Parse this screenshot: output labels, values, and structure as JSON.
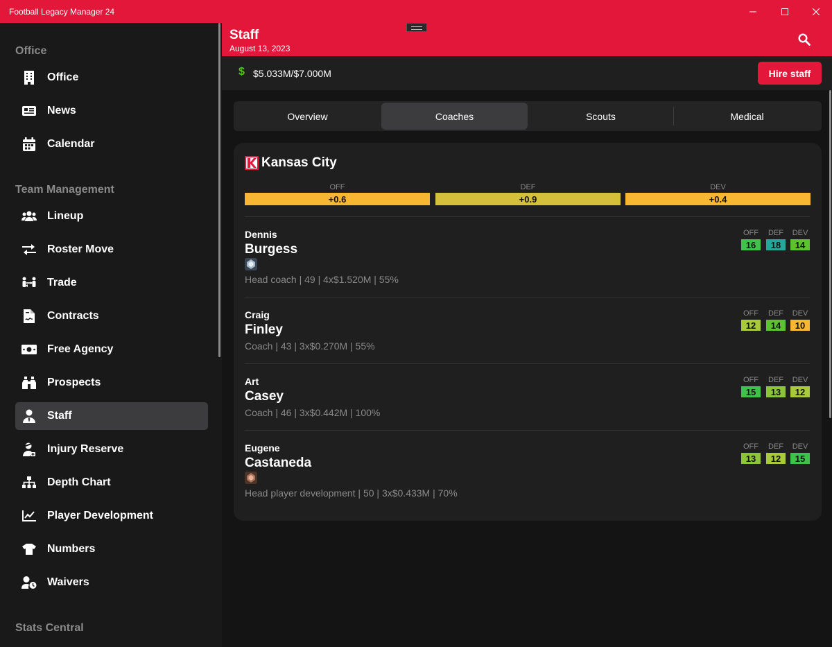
{
  "window": {
    "title": "Football Legacy Manager 24"
  },
  "sidebar": {
    "sections": [
      {
        "label": "Office"
      },
      {
        "label": "Team Management"
      },
      {
        "label": "Stats Central"
      }
    ],
    "items": [
      {
        "label": "Office",
        "icon": "building-icon"
      },
      {
        "label": "News",
        "icon": "newspaper-icon"
      },
      {
        "label": "Calendar",
        "icon": "calendar-icon"
      },
      {
        "label": "Lineup",
        "icon": "users-icon"
      },
      {
        "label": "Roster Move",
        "icon": "arrows-exchange-icon"
      },
      {
        "label": "Trade",
        "icon": "trade-icon"
      },
      {
        "label": "Contracts",
        "icon": "contract-icon"
      },
      {
        "label": "Free Agency",
        "icon": "money-bill-icon"
      },
      {
        "label": "Prospects",
        "icon": "binoculars-icon"
      },
      {
        "label": "Staff",
        "icon": "staff-icon",
        "active": true
      },
      {
        "label": "Injury Reserve",
        "icon": "injured-icon"
      },
      {
        "label": "Depth Chart",
        "icon": "hierarchy-icon"
      },
      {
        "label": "Player Development",
        "icon": "chart-line-icon"
      },
      {
        "label": "Numbers",
        "icon": "shirt-icon"
      },
      {
        "label": "Waivers",
        "icon": "user-clock-icon"
      }
    ]
  },
  "header": {
    "title": "Staff",
    "date": "August 13, 2023"
  },
  "budget": {
    "symbol": "$",
    "text": "$5.033M/$7.000M",
    "hire_label": "Hire staff"
  },
  "tabs": [
    {
      "label": "Overview"
    },
    {
      "label": "Coaches",
      "active": true
    },
    {
      "label": "Scouts"
    },
    {
      "label": "Medical"
    }
  ],
  "team": {
    "name": "Kansas City",
    "logo_letter": "K",
    "ratings": [
      {
        "label": "OFF",
        "value": "+0.6",
        "color": "#f7b733"
      },
      {
        "label": "DEF",
        "value": "+0.9",
        "color": "#d4c03a"
      },
      {
        "label": "DEV",
        "value": "+0.4",
        "color": "#f7b733"
      }
    ]
  },
  "coaches": [
    {
      "first": "Dennis",
      "last": "Burgess",
      "badge": "silver-badge-icon",
      "meta": "Head coach | 49 | 4x$1.520M | 55%",
      "stats": [
        {
          "label": "OFF",
          "value": "16",
          "color": "#3ec24a"
        },
        {
          "label": "DEF",
          "value": "18",
          "color": "#26a69a"
        },
        {
          "label": "DEV",
          "value": "14",
          "color": "#5cc232"
        }
      ]
    },
    {
      "first": "Craig",
      "last": "Finley",
      "badge": null,
      "meta": "Coach | 43 | 3x$0.270M | 55%",
      "stats": [
        {
          "label": "OFF",
          "value": "12",
          "color": "#a8c93a"
        },
        {
          "label": "DEF",
          "value": "14",
          "color": "#5cc232"
        },
        {
          "label": "DEV",
          "value": "10",
          "color": "#f7b733"
        }
      ]
    },
    {
      "first": "Art",
      "last": "Casey",
      "badge": null,
      "meta": "Coach | 46 | 3x$0.442M | 100%",
      "stats": [
        {
          "label": "OFF",
          "value": "15",
          "color": "#3ec24a"
        },
        {
          "label": "DEF",
          "value": "13",
          "color": "#8cc43a"
        },
        {
          "label": "DEV",
          "value": "12",
          "color": "#a8c93a"
        }
      ]
    },
    {
      "first": "Eugene",
      "last": "Castaneda",
      "badge": "bronze-badge-icon",
      "meta": "Head player development | 50 | 3x$0.433M | 70%",
      "stats": [
        {
          "label": "OFF",
          "value": "13",
          "color": "#8cc43a"
        },
        {
          "label": "DEF",
          "value": "12",
          "color": "#a8c93a"
        },
        {
          "label": "DEV",
          "value": "15",
          "color": "#3ec24a"
        }
      ]
    }
  ]
}
